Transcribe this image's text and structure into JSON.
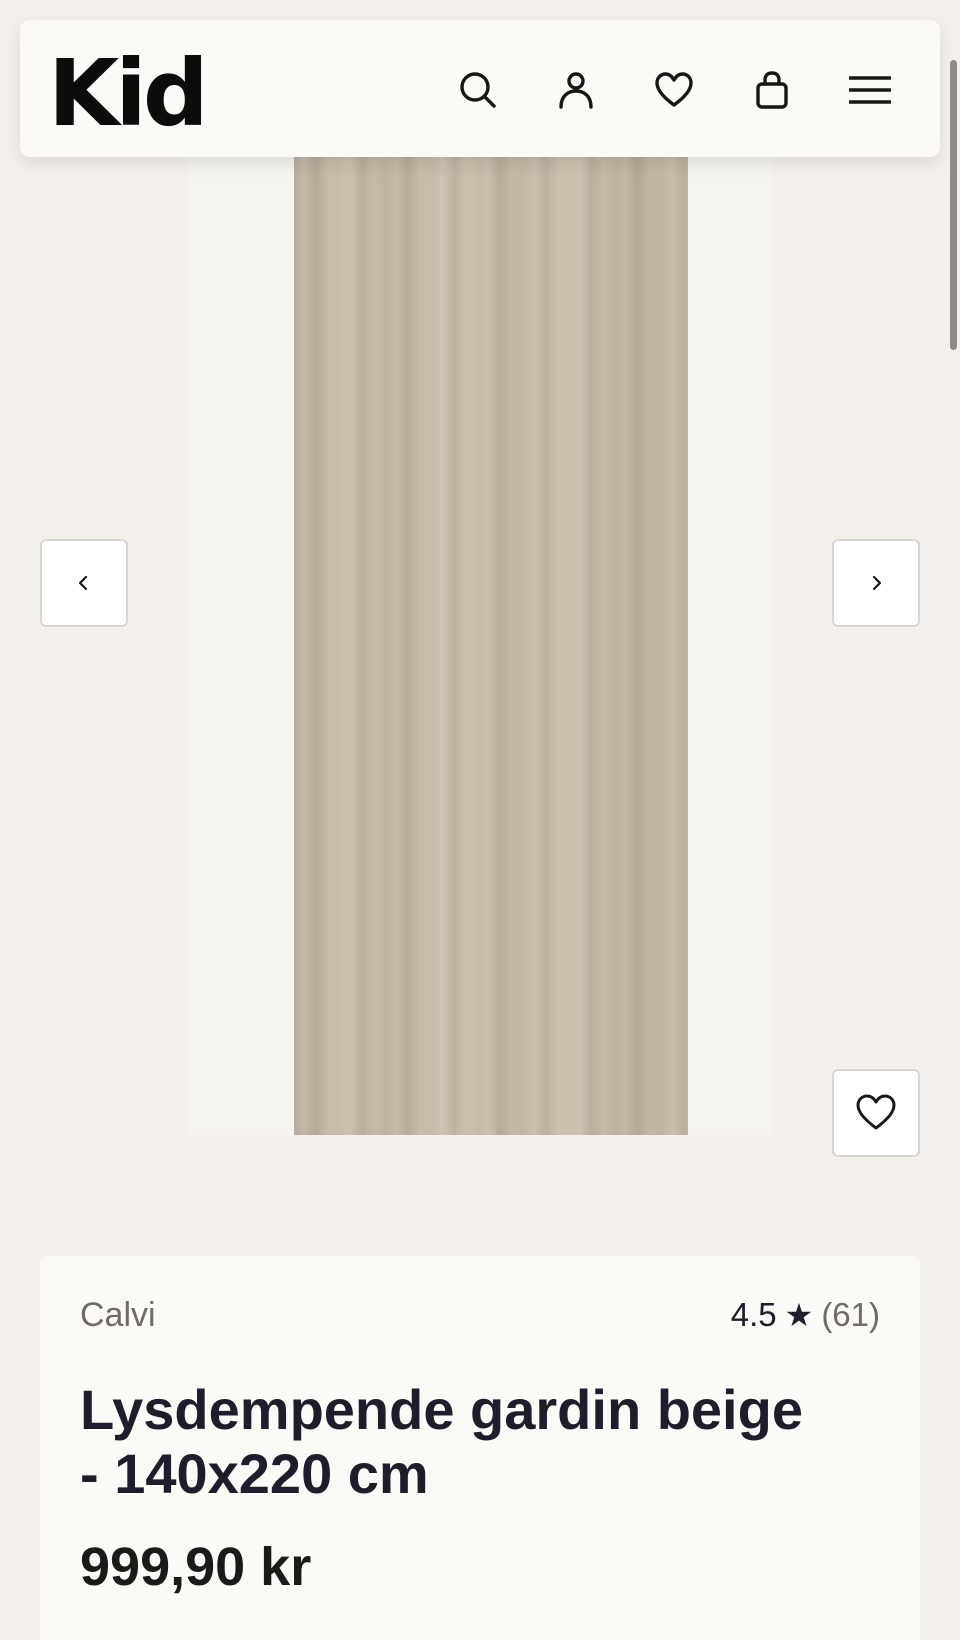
{
  "header": {
    "logo_text": "Kid",
    "icons": [
      "search-icon",
      "user-icon",
      "heart-icon",
      "bag-icon",
      "menu-icon"
    ]
  },
  "gallery": {
    "image_description_icon": "curtain-image",
    "prev_icon": "chevron-left-icon",
    "next_icon": "chevron-right-icon",
    "favorite_icon": "heart-icon"
  },
  "product": {
    "brand": "Calvi",
    "rating_score": "4.5",
    "rating_star": "★",
    "rating_count": "(61)",
    "title": "Lysdempende gardin beige - 140x220 cm",
    "price": "999,90 kr"
  },
  "colors": {
    "background": "#f4f1ec",
    "card": "#fbfaf6",
    "text": "#1f1d2b",
    "muted": "#6f6c68",
    "curtain": "#c6baa7"
  }
}
